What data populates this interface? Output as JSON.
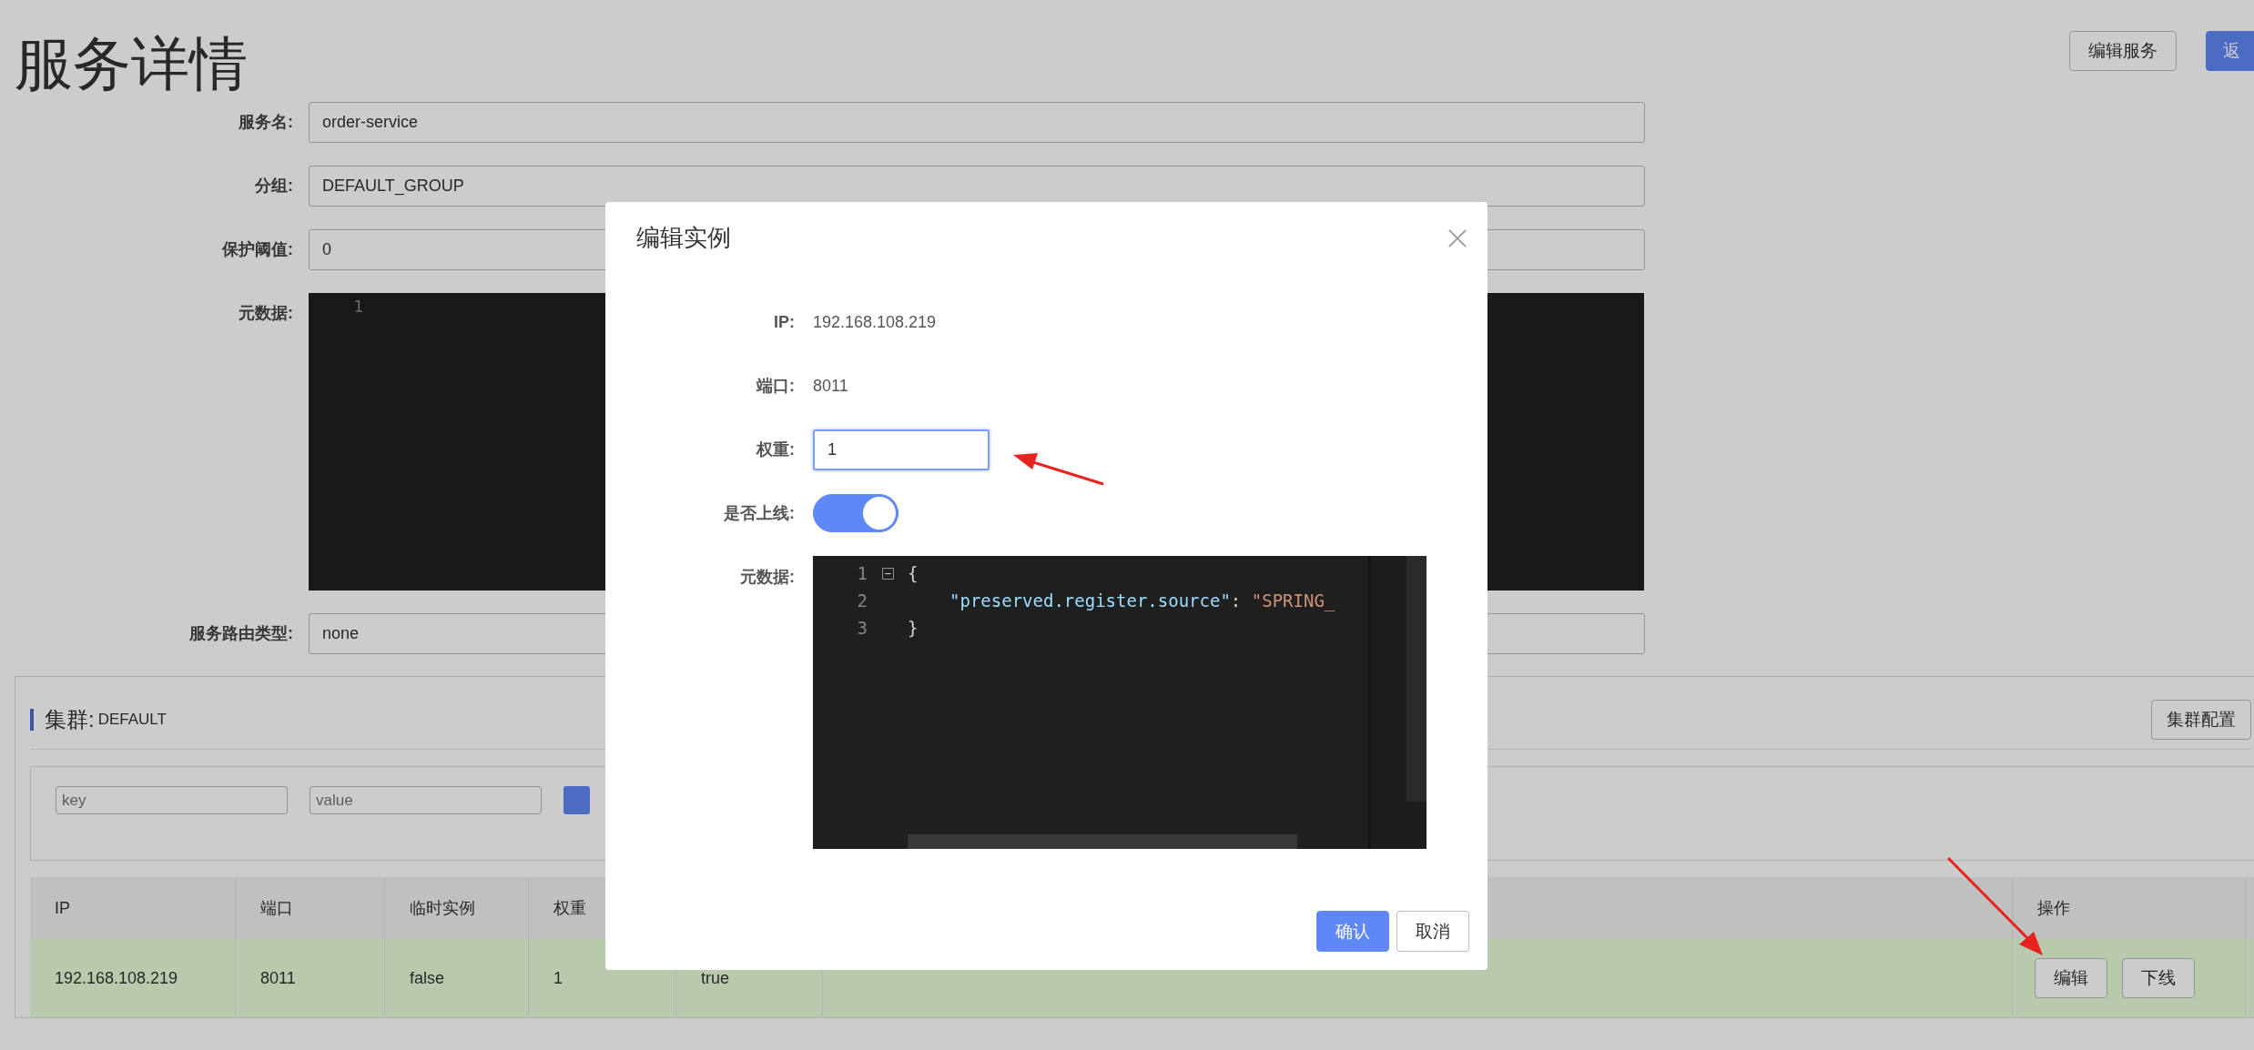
{
  "page": {
    "title": "服务详情",
    "buttons": [
      {
        "label": "编辑服务",
        "kind": "default"
      },
      {
        "label": "返",
        "kind": "primary"
      }
    ]
  },
  "form": [
    {
      "label": "服务名:",
      "kind": "field",
      "value": "order-service"
    },
    {
      "label": "分组:",
      "kind": "field",
      "value": "DEFAULT_GROUP"
    },
    {
      "label": "保护阈值:",
      "kind": "field",
      "value": "0"
    },
    {
      "label": "元数据:",
      "kind": "editor",
      "lines": [
        "1"
      ]
    },
    {
      "label": "服务路由类型:",
      "kind": "field",
      "value": "none"
    }
  ],
  "cluster": {
    "title": "集群:",
    "name": "DEFAULT",
    "config_button": "集群配置",
    "filter": {
      "key_placeholder": "key",
      "value_placeholder": "value"
    },
    "table": {
      "columns": [
        "IP",
        "端口",
        "临时实例",
        "权重",
        "",
        "",
        "操作"
      ],
      "rows": [
        {
          "cells": [
            "192.168.108.219",
            "8011",
            "false",
            "1",
            "true",
            ""
          ],
          "actions": [
            "编辑",
            "下线"
          ]
        }
      ]
    }
  },
  "modal": {
    "title": "编辑实例",
    "ip_label": "IP:",
    "ip": "192.168.108.219",
    "port_label": "端口:",
    "port": "8011",
    "weight_label": "权重:",
    "weight": "1",
    "online_label": "是否上线:",
    "online": true,
    "metadata_label": "元数据:",
    "editor_lines": [
      {
        "number": "1",
        "tokens": [
          {
            "kind": "brace",
            "text": "{"
          }
        ]
      },
      {
        "number": "2",
        "tokens": [
          {
            "kind": "key",
            "text": "\"preserved.register.source\""
          },
          {
            "kind": "punct",
            "text": ": "
          },
          {
            "kind": "string",
            "text": "\"SPRING_"
          }
        ]
      },
      {
        "number": "3",
        "tokens": [
          {
            "kind": "brace",
            "text": "}"
          }
        ]
      }
    ],
    "confirm": "确认",
    "cancel": "取消"
  }
}
